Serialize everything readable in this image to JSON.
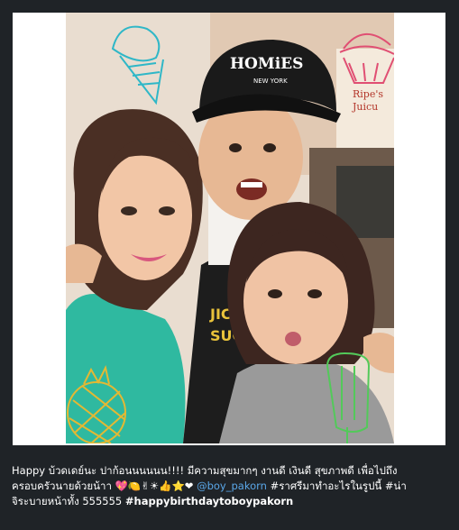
{
  "post": {
    "caption_line1_prefix": "Happy",
    "caption_line1_text": " บ้วดเดย์นะ ปาก้อนนนนนน!!!! มีความสุขมากๆ งานดี เงินดี สุขภาพดี เพื่อไปถึง",
    "caption_line2_text": "ครอบครัวนายด้วยน้าา ",
    "caption_emojis": "💖🍋✌☀👍⭐❤",
    "mention": "@boy_pakorn",
    "hashtag_1": "#ราศรีมาทำอะไรในรูปนี้ #น่า",
    "caption_line3_text": "จิระบายหน้าทั้ง 555555 ",
    "hashtag_2": "#happybirthdaytoboypakorn"
  },
  "photo": {
    "cap_text_line1": "HOMiES",
    "cap_text_line2": "NEW YORK",
    "shirt_text_1": "JICKA",
    "shirt_text_2": "SUCK",
    "sign_text_1": "Ripe's",
    "sign_text_2": "Juicu"
  },
  "colors": {
    "background": "#1f2327",
    "card": "#ffffff",
    "caption_text": "#ffffff",
    "mention": "#5aa7e8"
  },
  "icons": [
    "ice-cream-doodle-icon",
    "cupcake-doodle-icon",
    "pineapple-doodle-icon",
    "popsicle-doodle-icon"
  ]
}
